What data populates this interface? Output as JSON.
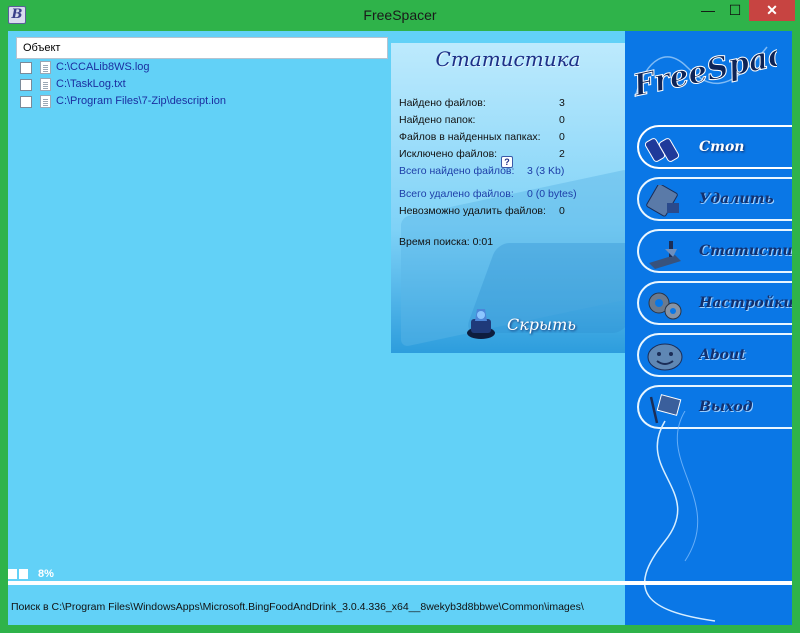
{
  "window": {
    "title": "FreeSpacer",
    "icon_letter": "B",
    "minimize_glyph": "—",
    "maximize_glyph": "☐",
    "close_glyph": "✕",
    "colors": {
      "frame": "#2fb34a",
      "client": "#62d1f7",
      "menu": "#0a77e6",
      "close": "#c74441"
    }
  },
  "filelist": {
    "column_header": "Объект",
    "rows": [
      {
        "path": "C:\\CCALib8WS.log",
        "checked": false
      },
      {
        "path": "C:\\TaskLog.txt",
        "checked": false
      },
      {
        "path": "C:\\Program Files\\7-Zip\\descript.ion",
        "checked": false
      }
    ]
  },
  "stats": {
    "title": "Статистика",
    "found_files_label": "Найдено файлов:",
    "found_files_value": "3",
    "found_folders_label": "Найдено папок:",
    "found_folders_value": "0",
    "files_in_folders_label": "Файлов в найденных папках:",
    "files_in_folders_value": "0",
    "excluded_label": "Исключено файлов:",
    "excluded_value": "2",
    "total_found_label": "Всего найдено файлов:",
    "total_found_value": "3 (3 Kb)",
    "total_deleted_label": "Всего удалено файлов:",
    "total_deleted_value": "0 (0 bytes)",
    "cannot_delete_label": "Невозможно удалить файлов:",
    "cannot_delete_value": "0",
    "search_time": "Время поиска: 0:01",
    "help_glyph": "?",
    "hide_label": "Скрыть"
  },
  "menu": {
    "logo_text": "FreeSpacer",
    "items": [
      {
        "label": "Стоп",
        "icon": "stop-icon",
        "active": true
      },
      {
        "label": "Удалить",
        "icon": "delete-icon",
        "active": false
      },
      {
        "label": "Статистика",
        "icon": "statistics-icon",
        "active": false
      },
      {
        "label": "Настройки",
        "icon": "settings-icon",
        "active": false
      },
      {
        "label": "About",
        "icon": "about-icon",
        "active": false
      },
      {
        "label": "Выход",
        "icon": "exit-icon",
        "active": false
      }
    ]
  },
  "progress": {
    "percent_text": "8%",
    "fraction": 0.08
  },
  "status": {
    "text": "Поиск в C:\\Program Files\\WindowsApps\\Microsoft.BingFoodAndDrink_3.0.4.336_x64__8wekyb3d8bbwe\\Common\\images\\"
  }
}
